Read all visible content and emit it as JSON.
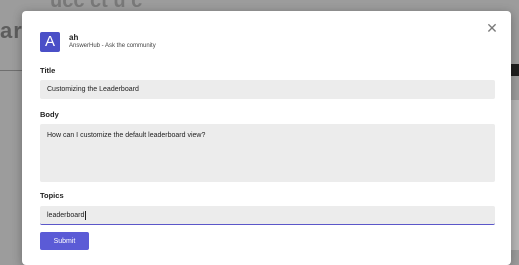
{
  "background": {
    "title_fragment": "ari",
    "top_fragment": "ucc  ct  u  c"
  },
  "dialog": {
    "close_icon": "close-icon",
    "app": {
      "logo_letter": "A",
      "name": "ah",
      "subtitle": "AnswerHub - Ask the community",
      "accent": "#4a4fc7"
    },
    "title": {
      "label": "Title",
      "value": "Customizing the Leaderboard"
    },
    "body": {
      "label": "Body",
      "value": "How can I customize the default leaderboard view?"
    },
    "topics": {
      "label": "Topics",
      "value": "leaderboard"
    },
    "submit_label": "Submit",
    "submit_color": "#5b5bd6"
  }
}
